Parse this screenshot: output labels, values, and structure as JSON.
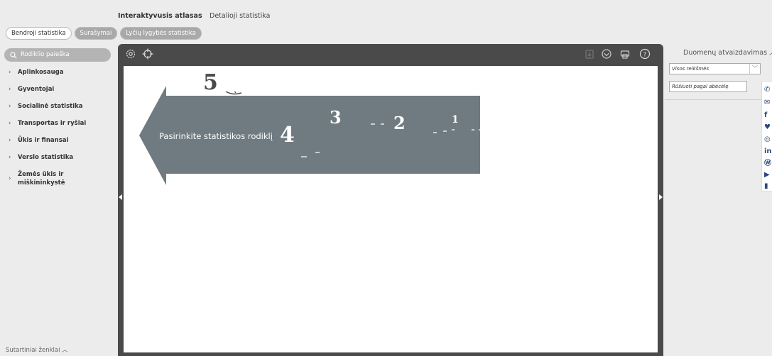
{
  "topnav": {
    "atlas": "Interaktyvusis atlasas",
    "detailed": "Detalioji statistika"
  },
  "tabs": [
    "Bendroji statistika",
    "Surašymai",
    "Lyčių lygybės statistika"
  ],
  "sidebar": {
    "search_label": "Rodiklio paieška",
    "items": [
      "Aplinkosauga",
      "Gyventojai",
      "Socialinė statistika",
      "Transportas ir ryšiai",
      "Ūkis ir finansai",
      "Verslo statistika",
      "Žemės ūkis ir miškininkystė"
    ],
    "legend_label": "Sutartiniai ženklai"
  },
  "map": {
    "hint": "Pasirinkite statistikos rodiklį",
    "numbers": [
      "5",
      "4",
      "3",
      "2",
      "1"
    ]
  },
  "right_panel": {
    "title": "Duomenų atvaizdavimas",
    "value_select": "Visos reikšmės",
    "sort_select": "Rūšiuoti pagal abėcėlę"
  },
  "social_icons": [
    "phone-icon",
    "mail-icon",
    "facebook-icon",
    "twitter-icon",
    "instagram-icon",
    "linkedin-icon",
    "wordpress-icon",
    "youtube-icon",
    "blog-icon"
  ],
  "colors": {
    "map_frame": "#4a4a4a",
    "arrow": "#6f7b80",
    "tab_inactive": "#a9a9a9",
    "background": "#ececec"
  }
}
